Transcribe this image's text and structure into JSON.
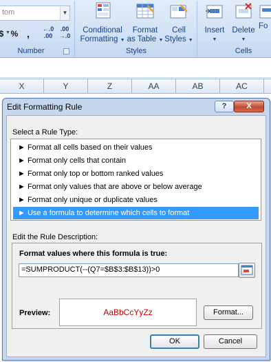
{
  "ribbon": {
    "number_format_value": "tom",
    "currency_symbol": "$",
    "percent_symbol": "%",
    "comma_symbol": ",",
    "increase_decimal_label": "←.0 .00",
    "decrease_decimal_label": ".00 →.0",
    "number_group_label": "Number",
    "styles_group_label": "Styles",
    "cells_group_label": "Cells",
    "conditional_formatting_line1": "Conditional",
    "conditional_formatting_line2": "Formatting",
    "format_as_table_line1": "Format",
    "format_as_table_line2": "as Table",
    "cell_styles_line1": "Cell",
    "cell_styles_line2": "Styles",
    "insert_label": "Insert",
    "delete_label": "Delete",
    "format_label": "Fo"
  },
  "columns": [
    "X",
    "Y",
    "Z",
    "AA",
    "AB",
    "AC"
  ],
  "dialog": {
    "title": "Edit Formatting Rule",
    "help_glyph": "?",
    "close_glyph": "X",
    "select_rule_type_label": "Select a Rule Type:",
    "rule_types": [
      "► Format all cells based on their values",
      "► Format only cells that contain",
      "► Format only top or bottom ranked values",
      "► Format only values that are above or below average",
      "► Format only unique or duplicate values",
      "► Use a formula to determine which cells to format"
    ],
    "selected_index": 5,
    "edit_description_label": "Edit the Rule Description:",
    "formula_caption": "Format values where this formula is true:",
    "formula_value": "=SUMPRODUCT(--(Q7=$B$3:$B$13))>0",
    "preview_label": "Preview:",
    "preview_text": "AaBbCcYyZz",
    "format_button": "Format...",
    "ok_button": "OK",
    "cancel_button": "Cancel"
  },
  "colors": {
    "selection": "#3399ff",
    "preview_text": "#c00000",
    "ribbon_text": "#15428b"
  }
}
